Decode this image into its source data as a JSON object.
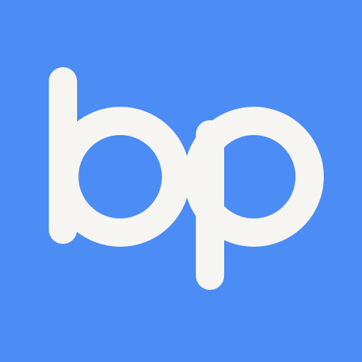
{
  "logo": {
    "text": "bp",
    "background_color": "#4b8cf5",
    "letter_color": "#f6f5f1"
  }
}
